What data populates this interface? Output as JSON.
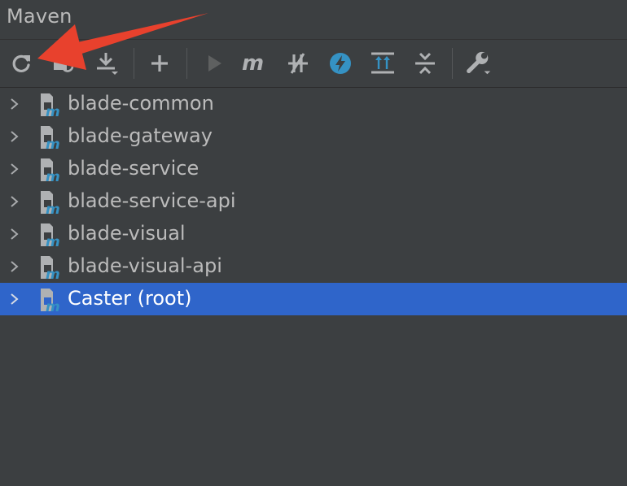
{
  "window": {
    "title": "Maven"
  },
  "toolbar": {
    "buttons": [
      {
        "icon": "reload-icon"
      },
      {
        "icon": "generate-sources-icon"
      },
      {
        "icon": "download-icon"
      },
      {
        "icon": "add-icon"
      },
      {
        "icon": "run-icon"
      },
      {
        "icon": "maven-goal-icon"
      },
      {
        "icon": "toggle-skip-tests-icon"
      },
      {
        "icon": "offline-mode-icon"
      },
      {
        "icon": "show-dependencies-icon"
      },
      {
        "icon": "collapse-all-icon"
      },
      {
        "icon": "settings-icon"
      }
    ]
  },
  "tree": {
    "items": [
      {
        "label": "blade-common",
        "selected": false
      },
      {
        "label": "blade-gateway",
        "selected": false
      },
      {
        "label": "blade-service",
        "selected": false
      },
      {
        "label": "blade-service-api",
        "selected": false
      },
      {
        "label": "blade-visual",
        "selected": false
      },
      {
        "label": "blade-visual-api",
        "selected": false
      },
      {
        "label": "Caster (root)",
        "selected": true
      }
    ]
  },
  "colors": {
    "panel_bg": "#3c3f41",
    "selection": "#2f65ca",
    "annotation_arrow": "#e8412d",
    "maven_icon_accent": "#3592c4"
  }
}
